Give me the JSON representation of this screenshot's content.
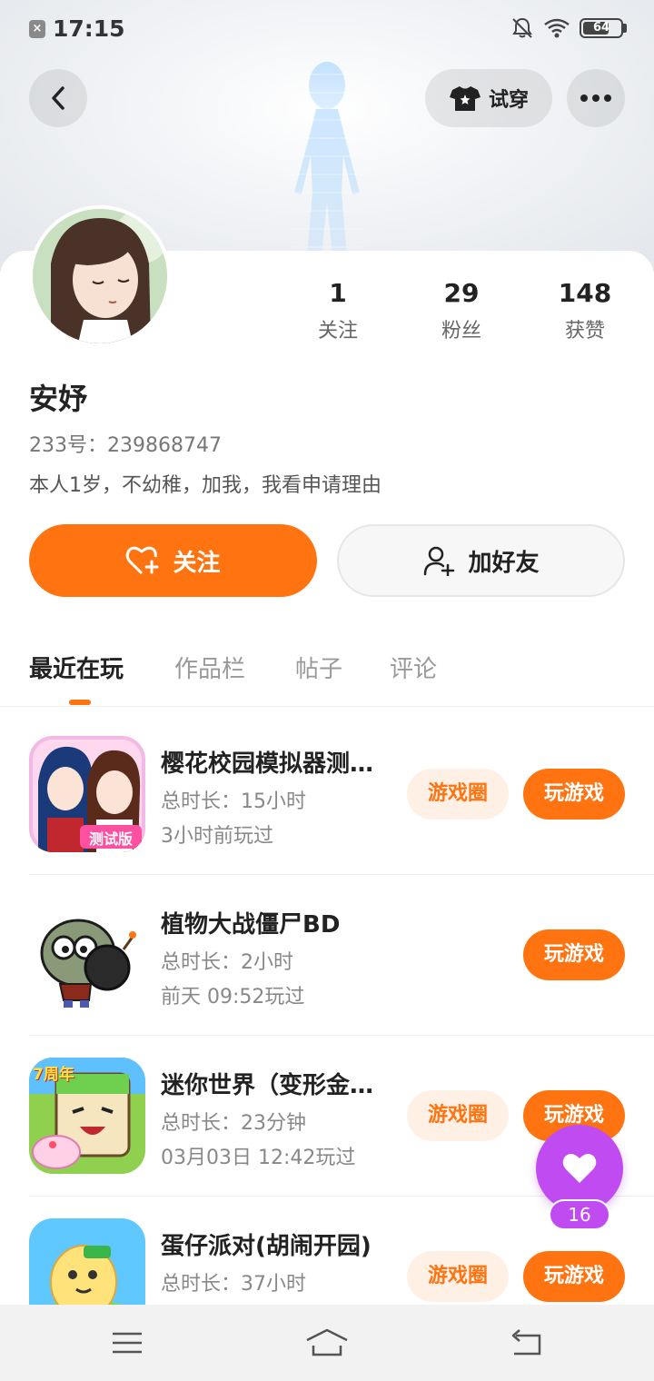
{
  "status_bar": {
    "time": "17:15",
    "battery": "64"
  },
  "header": {
    "tryon_label": "试穿"
  },
  "profile": {
    "username": "安妤",
    "user_id": "233号：239868747",
    "bio": "本人1岁，不幼稚，加我，我看申请理由"
  },
  "stats": [
    {
      "value": "1",
      "label": "关注"
    },
    {
      "value": "29",
      "label": "粉丝"
    },
    {
      "value": "148",
      "label": "获赞"
    }
  ],
  "actions": {
    "follow_label": "关注",
    "add_friend_label": "加好友"
  },
  "tabs": [
    {
      "label": "最近在玩",
      "active": true
    },
    {
      "label": "作品栏",
      "active": false
    },
    {
      "label": "帖子",
      "active": false
    },
    {
      "label": "评论",
      "active": false
    }
  ],
  "games": [
    {
      "name": "樱花校园模拟器测试版",
      "duration": "总时长：15小时",
      "last_played": "3小时前玩过",
      "circle_label": "游戏圈",
      "play_label": "玩游戏",
      "has_circle": true,
      "icon_badge": "测试版"
    },
    {
      "name": "植物大战僵尸BD",
      "duration": "总时长：2小时",
      "last_played": "前天 09:52玩过",
      "play_label": "玩游戏",
      "has_circle": false
    },
    {
      "name": "迷你世界（变形金刚）",
      "duration": "总时长：23分钟",
      "last_played": "03月03日 12:42玩过",
      "circle_label": "游戏圈",
      "play_label": "玩游戏",
      "has_circle": true,
      "icon_badge": "7周年"
    },
    {
      "name": "蛋仔派对(胡闹开园)",
      "duration": "总时长：37小时",
      "last_played": "",
      "circle_label": "游戏圈",
      "play_label": "玩游戏",
      "has_circle": true
    }
  ],
  "like_fab": {
    "count": "16"
  },
  "colors": {
    "accent": "#ff7410",
    "accent_light": "#fff0e6",
    "fab": "#c04bf0"
  },
  "icons": [
    "back-icon",
    "tshirt-icon",
    "more-icon",
    "heart-plus-icon",
    "person-add-icon",
    "heart-icon",
    "menu-icon",
    "home-icon",
    "return-icon"
  ]
}
